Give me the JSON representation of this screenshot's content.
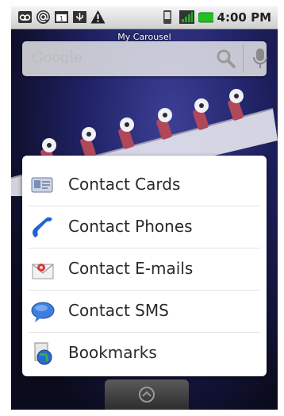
{
  "status_bar": {
    "left_icons": [
      "voicemail-icon",
      "at-icon",
      "calendar-icon",
      "usb-icon",
      "warning-icon"
    ],
    "right_icons": [
      "phone-icon",
      "signal-icon",
      "battery-icon"
    ],
    "calendar_day": "1",
    "time": "4:00 PM",
    "colors": {
      "battery": "#22c022",
      "signal": "#22aa22"
    }
  },
  "widget": {
    "carousel_title": "My Carousel",
    "search_placeholder": "Google",
    "search_icon": "search-icon",
    "mic_icon": "microphone-icon"
  },
  "menu": {
    "items": [
      {
        "label": "Contact Cards",
        "icon": "contact-card-icon"
      },
      {
        "label": "Contact Phones",
        "icon": "phone-handset-icon"
      },
      {
        "label": "Contact E-mails",
        "icon": "email-icon"
      },
      {
        "label": "Contact SMS",
        "icon": "sms-bubble-icon"
      },
      {
        "label": "Bookmarks",
        "icon": "bookmark-globe-icon"
      }
    ]
  },
  "launcher": {
    "icon": "launcher-up-icon"
  },
  "colors": {
    "wallpaper": "#1f2163",
    "menu_bg": "#ffffff",
    "menu_text": "#2a2a2a"
  }
}
